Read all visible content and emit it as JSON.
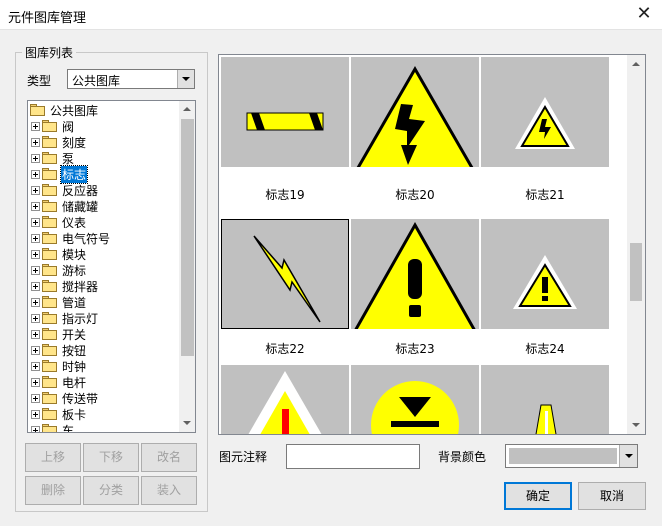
{
  "window": {
    "title": "元件图库管理",
    "close_glyph": "✕"
  },
  "library": {
    "group_title": "图库列表",
    "type_label": "类型",
    "type_value": "公共图库",
    "root": "公共图库",
    "items": [
      "阀",
      "刻度",
      "泵",
      "标志",
      "反应器",
      "储藏罐",
      "仪表",
      "电气符号",
      "模块",
      "游标",
      "搅拌器",
      "管道",
      "指示灯",
      "开关",
      "按钮",
      "时钟",
      "电杆",
      "传送带",
      "板卡",
      "车"
    ],
    "selected_item": "标志"
  },
  "buttons": {
    "move_up": "上移",
    "move_down": "下移",
    "rename": "改名",
    "delete": "删除",
    "categorize": "分类",
    "import": "装入",
    "ok": "确定",
    "cancel": "取消"
  },
  "gallery": {
    "captions": [
      "标志19",
      "标志20",
      "标志21",
      "标志22",
      "标志23",
      "标志24"
    ],
    "selected": "标志22"
  },
  "fields": {
    "annotation_label": "图元注释",
    "annotation_value": "",
    "bg_color_label": "背景颜色",
    "bg_color_value": "#c0c0c0"
  },
  "colors": {
    "symbol_yellow": "#ffff00",
    "cell_gray": "#c0c0c0",
    "selection_blue": "#0078d7"
  }
}
